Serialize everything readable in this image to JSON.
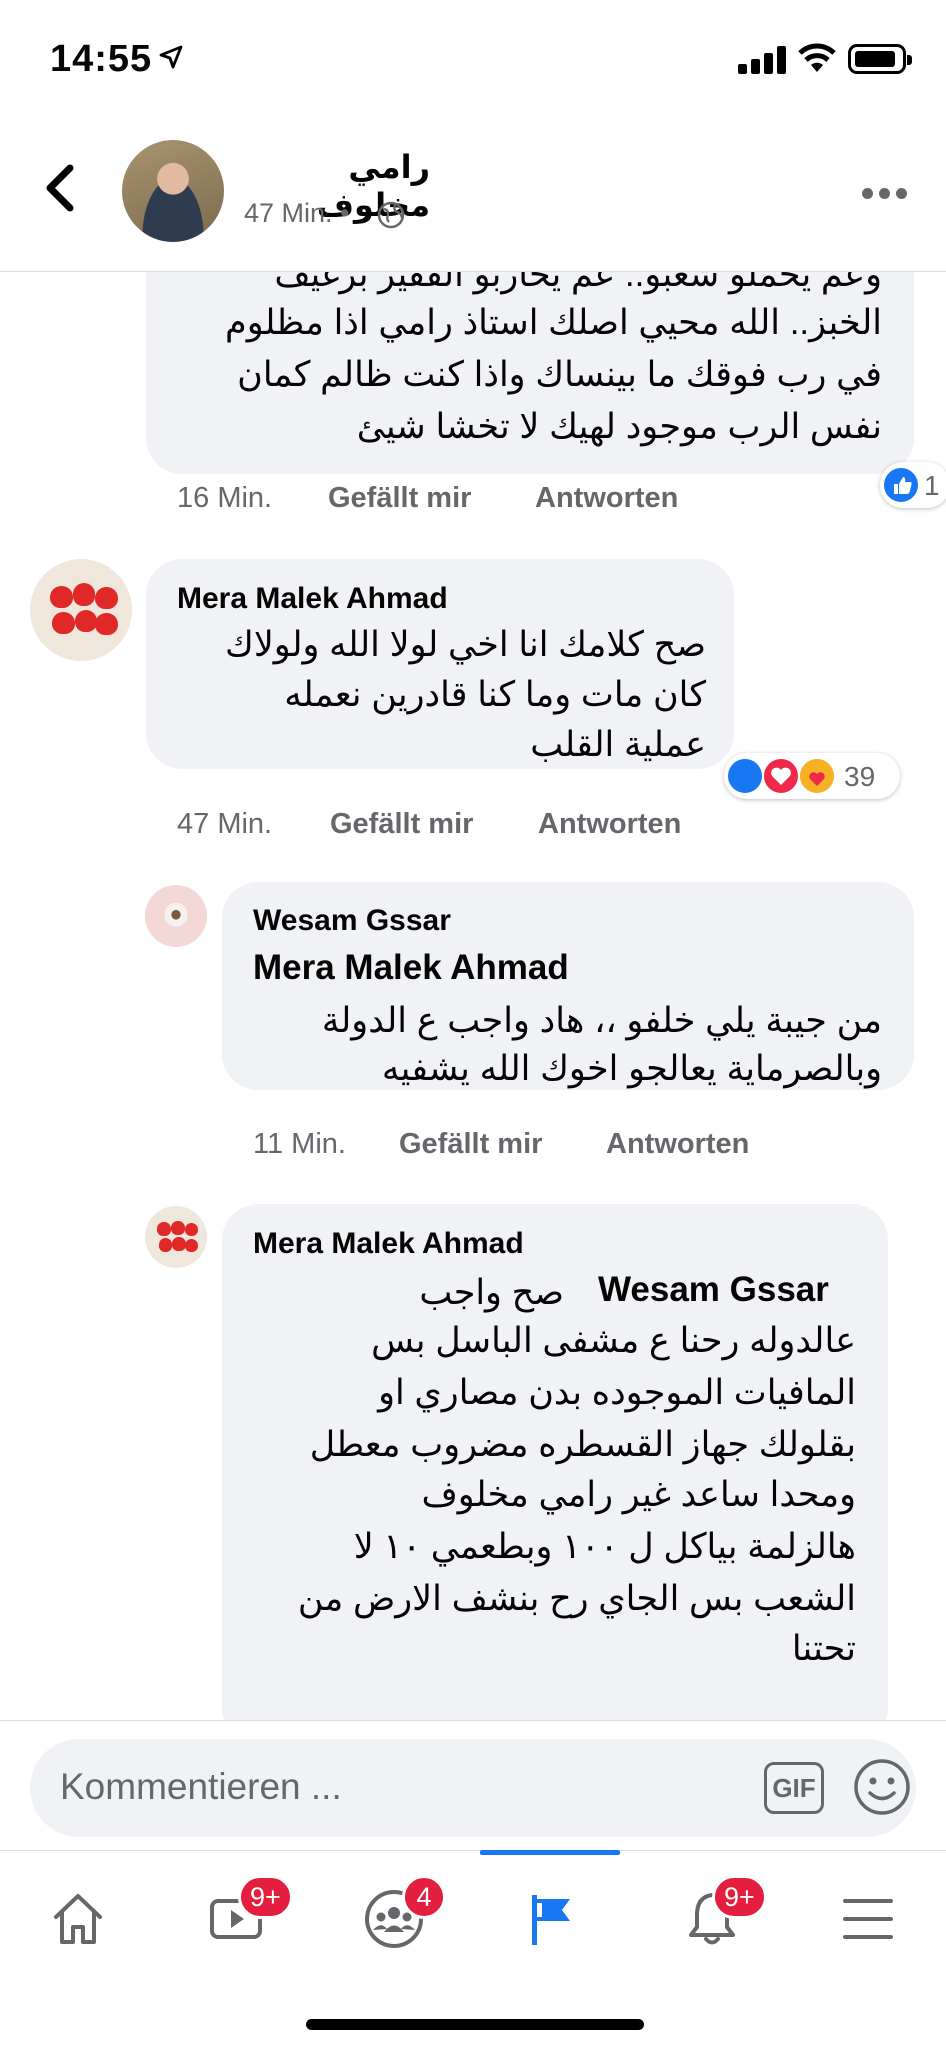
{
  "status_bar": {
    "time": "14:55"
  },
  "post_header": {
    "author": "رامي مخلوف",
    "time": "47 Min. •",
    "back_icon": "chevron-left-icon",
    "privacy_icon": "globe-icon",
    "more_icon": "more-horizontal-icon"
  },
  "comments": [
    {
      "id": "c1",
      "partial_top_line": "وعم يحملو شعبو.. عم يحاربو الفقير برغيف",
      "lines": [
        "الخبز.. الله محيي اصلك استاذ رامي اذا مظلوم",
        "في رب فوقك ما بينساك واذا كنت ظالم كمان",
        "نفس الرب موجود لهيك لا تخشا شيئ"
      ],
      "time": "16 Min.",
      "like": "Gefällt mir",
      "reply": "Antworten",
      "reaction_count": "1"
    },
    {
      "id": "c2",
      "author": "Mera Malek Ahmad",
      "lines": [
        "صح كلامك انا اخي لولا الله ولولاك",
        "كان مات وما كنا قادرين نعمله",
        "عملية القلب"
      ],
      "time": "47 Min.",
      "like": "Gefällt mir",
      "reply": "Antworten",
      "reaction_count": "39"
    },
    {
      "id": "c3",
      "author": "Wesam Gssar",
      "mention": "Mera Malek Ahmad",
      "lines": [
        "من جيبة يلي خلفو ،، هاد واجب ع الدولة",
        "وبالصرماية يعالجو اخوك الله يشفيه"
      ],
      "time": "11 Min.",
      "like": "Gefällt mir",
      "reply": "Antworten"
    },
    {
      "id": "c4",
      "author": "Mera Malek Ahmad",
      "mention": "Wesam Gssar",
      "first_line_text": "صح واجب",
      "lines": [
        "عالدوله رحنا ع مشفى الباسل بس",
        "المافيات الموجوده بدن مصاري او",
        "بقلولك جهاز القسطره مضروب معطل",
        "ومحدا ساعد غير رامي مخلوف",
        "هالزلمة بياكل ل ١٠٠ وبطعمي ١٠ لا",
        "الشعب بس الجاي رح بنشف الارض من",
        "تحتنا"
      ]
    }
  ],
  "composer": {
    "placeholder": "Kommentieren ...",
    "gif_label": "GIF",
    "emoji_icon": "smiley-icon"
  },
  "tabbar": {
    "tabs": [
      {
        "icon": "home-icon"
      },
      {
        "icon": "video-icon",
        "badge": "9+"
      },
      {
        "icon": "groups-icon",
        "badge": "4"
      },
      {
        "icon": "pages-flag-icon",
        "active": true
      },
      {
        "icon": "bell-icon",
        "badge": "9+"
      },
      {
        "icon": "menu-icon"
      }
    ]
  },
  "colors": {
    "accent": "#1877f2",
    "badge": "#e41e3f",
    "bubble": "#f0f2f5",
    "meta_text": "#65676b"
  }
}
